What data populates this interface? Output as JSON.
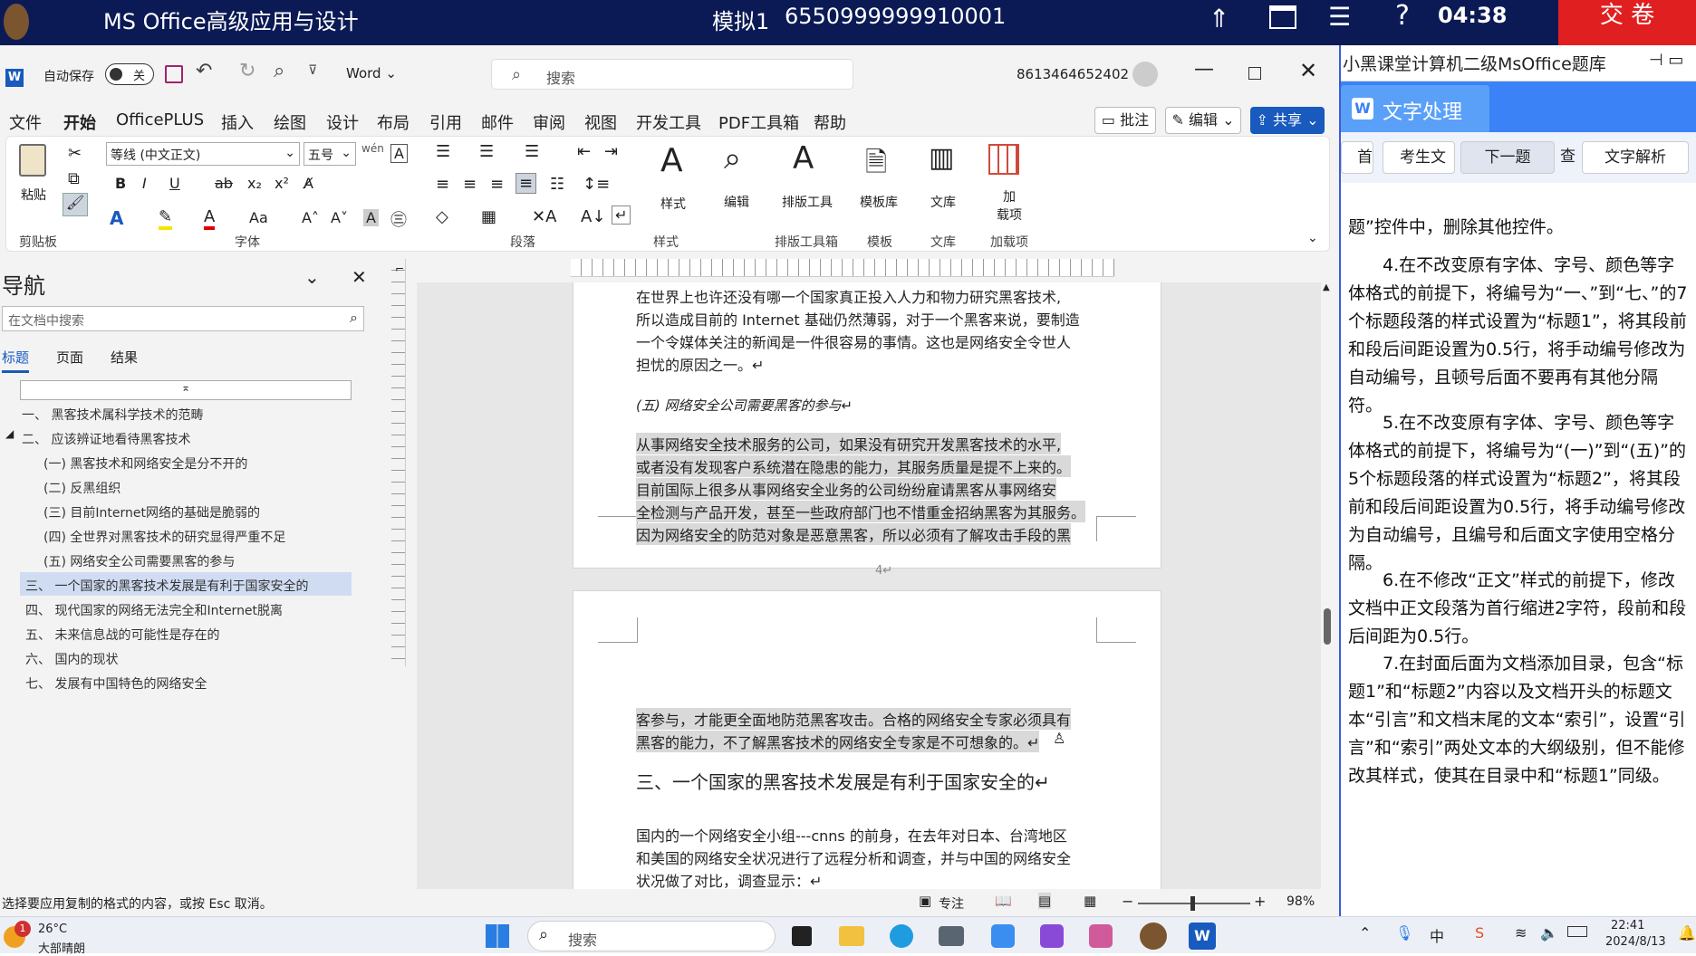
{
  "exam": {
    "title": "MS Office高级应用与设计",
    "sim": "模拟1",
    "id": "6550999999910001",
    "time": "04:38",
    "submit": "交 卷",
    "icons": [
      "logo-avatar-icon",
      "up-arrows-icon",
      "window-icon",
      "list-icon",
      "help-icon"
    ]
  },
  "word": {
    "autosave": "自动保存",
    "autosave_state": "关",
    "app_name": "Word",
    "search_placeholder": "搜索",
    "account": "8613464652402",
    "menu_tabs": [
      "文件",
      "开始",
      "OfficePLUS",
      "插入",
      "绘图",
      "设计",
      "布局",
      "引用",
      "邮件",
      "审阅",
      "视图",
      "开发工具",
      "PDF工具箱",
      "帮助"
    ],
    "btn_comment": "批注",
    "btn_edit": "编辑",
    "btn_share": "共享",
    "ribbon": {
      "paste": "粘贴",
      "clipboard": "剪贴板",
      "font_name": "等线 (中文正文)",
      "font_size": "五号",
      "font_group": "字体",
      "paragraph_group": "段落",
      "styles": "样式",
      "styles_group": "样式",
      "edit": "编辑",
      "layout_tool": "排版工具",
      "layout_group": "排版工具箱",
      "template": "模板库",
      "template_group": "模板",
      "library": "文库",
      "library_group": "文库",
      "addin": "加\n载项",
      "addin_group": "加载项"
    },
    "nav": {
      "title": "导航",
      "search_placeholder": "在文档中搜索",
      "tabs": [
        "标题",
        "页面",
        "结果"
      ],
      "items": [
        "一、  黑客技术属科学技术的范畴",
        "二、  应该辨证地看待黑客技术",
        "(一) 黑客技术和网络安全是分不开的",
        "(二) 反黑组织",
        "(三) 目前Internet网络的基础是脆弱的",
        "(四) 全世界对黑客技术的研究显得严重不足",
        "(五) 网络安全公司需要黑客的参与",
        "三、  一个国家的黑客技术发展是有利于国家安全的",
        "四、  现代国家的网络无法完全和Internet脱离",
        "五、  未来信息战的可能性是存在的",
        "六、  国内的现状",
        "七、  发展有中国特色的网络安全"
      ]
    },
    "doc": {
      "p1": [
        "在世界上也许还没有哪一个国家真正投入人力和物力研究黑客技术,",
        "所以造成目前的 Internet 基础仍然薄弱，对于一个黑客来说，要制造",
        "一个令媒体关注的新闻是一件很容易的事情。这也是网络安全令世人",
        "担忧的原因之一。↵"
      ],
      "heading5": "(五) 网络安全公司需要黑客的参与↵",
      "p2": [
        "从事网络安全技术服务的公司，如果没有研究开发黑客技术的水平,",
        "或者没有发现客户系统潜在隐患的能力，其服务质量是提不上来的。",
        "目前国际上很多从事网络安全业务的公司纷纷雇请黑客从事网络安",
        "全检测与产品开发，甚至一些政府部门也不惜重金招纳黑客为其服务。",
        "因为网络安全的防范对象是恶意黑客，所以必须有了解攻击手段的黑"
      ],
      "page_num": "4↵",
      "p3": [
        "客参与，才能更全面地防范黑客攻击。合格的网络安全专家必须具有",
        "黑客的能力，不了解黑客技术的网络安全专家是不可想象的。↵"
      ],
      "heading3": "三、一个国家的黑客技术发展是有利于国家安全的↵",
      "p4": [
        "国内的一个网络安全小组---cnns 的前身，在去年对日本、台湾地区",
        "和美国的网络安全状况进行了远程分析和调查，并与中国的网络安全",
        "状况做了对比，调查显示：↵"
      ]
    },
    "status": {
      "hint": "选择要应用复制的格式的内容，或按 Esc 取消。",
      "focus": "专注",
      "zoom": "98%"
    }
  },
  "panel": {
    "header": "小黑课堂计算机二级MsOffice题库",
    "section": "文字处理",
    "tabs": [
      "首",
      "考生文",
      "下一题",
      "查",
      "文字解析"
    ],
    "instructions": [
      "题”控件中，删除其他控件。",
      "4.在不改变原有字体、字号、颜色等字体格式的前提下，将编号为“一、”到“七、”的7个标题段落的样式设置为“标题1”，将其段前和段后间距设置为0.5行，将手动编号修改为自动编号，且顿号后面不要再有其他分隔符。",
      "5.在不改变原有字体、字号、颜色等字体格式的前提下，将编号为“(一)”到“(五)”的5个标题段落的样式设置为“标题2”，将其段前和段后间距设置为0.5行，将手动编号修改为自动编号，且编号和后面文字使用空格分隔。",
      "6.在不修改“正文”样式的前提下，修改文档中正文段落为首行缩进2字符，段前和段后间距为0.5行。",
      "7.在封面后面为文档添加目录，包含“标题1”和“标题2”内容以及文档开头的标题文本“引言”和文档末尾的文本“索引”，设置“引言”和“索引”两处文本的大纲级别，但不能修改其样式，使其在目录中和“标题1”同级。"
    ]
  },
  "taskbar": {
    "weather_temp": "26°C",
    "weather_desc": "大部晴朗",
    "badge": "1",
    "search": "搜索",
    "time": "22:41",
    "date": "2024/8/13"
  },
  "colors": {
    "exam_bar": "#0b1a55",
    "submit": "#e02020",
    "word_blue": "#185abd",
    "panel_blue": "#3b82f6"
  }
}
